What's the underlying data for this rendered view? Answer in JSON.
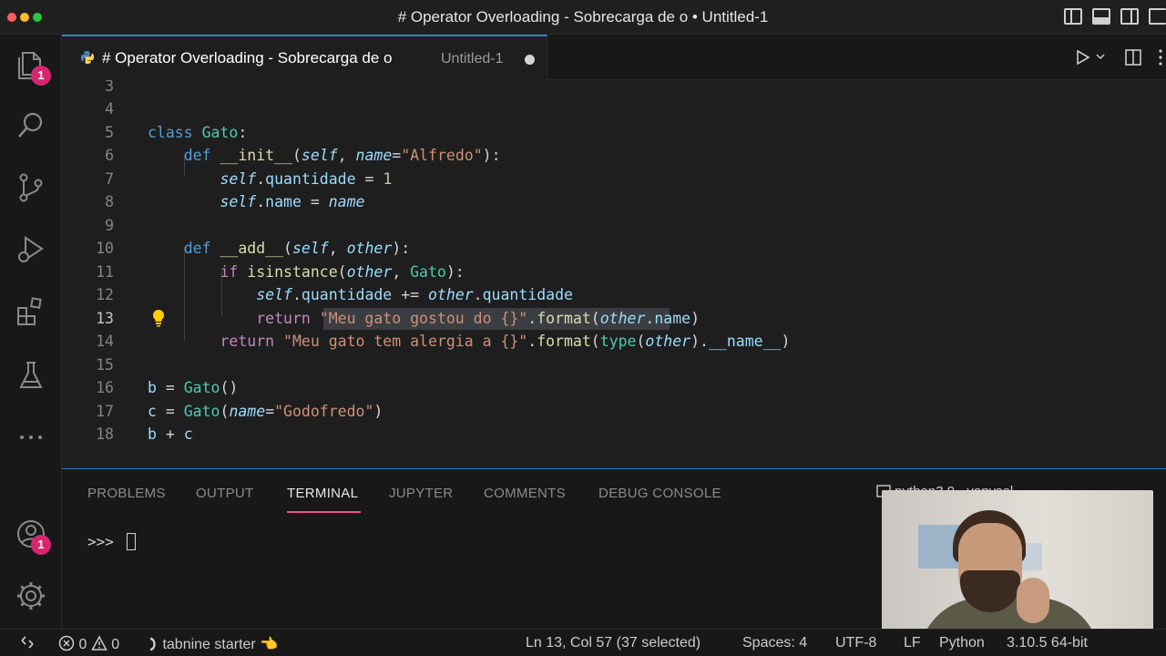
{
  "window": {
    "title": "# Operator Overloading - Sobrecarga de o • Untitled-1"
  },
  "activity": {
    "explorer_badge": "1",
    "accounts_badge": "1"
  },
  "tab": {
    "title": "# Operator Overloading - Sobrecarga de o",
    "description": "Untitled-1"
  },
  "editor": {
    "line_numbers": [
      "3",
      "4",
      "5",
      "6",
      "7",
      "8",
      "9",
      "10",
      "11",
      "12",
      "13",
      "14",
      "15",
      "16",
      "17",
      "18"
    ],
    "active_line": "13"
  },
  "panel": {
    "tabs": [
      "PROBLEMS",
      "OUTPUT",
      "TERMINAL",
      "JUPYTER",
      "COMMENTS",
      "DEBUG CONSOLE"
    ],
    "active_tab": "TERMINAL",
    "prompt": ">>> ",
    "kernel": "python3.9 - venvsol"
  },
  "status": {
    "errors": "0",
    "warnings": "0",
    "tabnine": "tabnine starter",
    "tabnine_emoji": "👈",
    "cursor": "Ln 13, Col 57 (37 selected)",
    "spaces": "Spaces: 4",
    "encoding": "UTF-8",
    "eol": "LF",
    "language": "Python",
    "interpreter": "3.10.5 64-bit"
  },
  "colors": {
    "accent": "#2e7fd6",
    "badge": "#d7266f",
    "terminal_underline": "#e7548a"
  }
}
